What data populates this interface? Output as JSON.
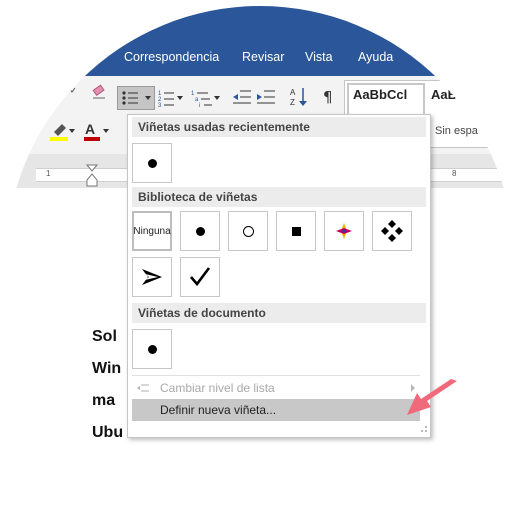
{
  "ribbon": {
    "tabs": [
      "Correspondencia",
      "Revisar",
      "Vista",
      "Ayuda"
    ],
    "styles": {
      "preview_1": "AaBbCcl",
      "preview_2": "AaBb",
      "style_name": "Sin espa"
    }
  },
  "ruler": {
    "tick_1": "1",
    "tick_8": "8"
  },
  "document": {
    "lines": [
      "Sol",
      "Win",
      "ma",
      "Ubu"
    ]
  },
  "bullet_menu": {
    "recent_heading": "Viñetas usadas recientemente",
    "library_heading": "Biblioteca de viñetas",
    "none_label": "Ninguna",
    "document_heading": "Viñetas de documento",
    "change_level_label": "Cambiar nivel de lista",
    "define_new_label": "Definir nueva viñeta..."
  },
  "colors": {
    "ribbon_blue": "#2b579a",
    "highlight_yellow": "#ffff00",
    "font_red": "#c00000",
    "pointer_pink": "#f06a7c"
  }
}
